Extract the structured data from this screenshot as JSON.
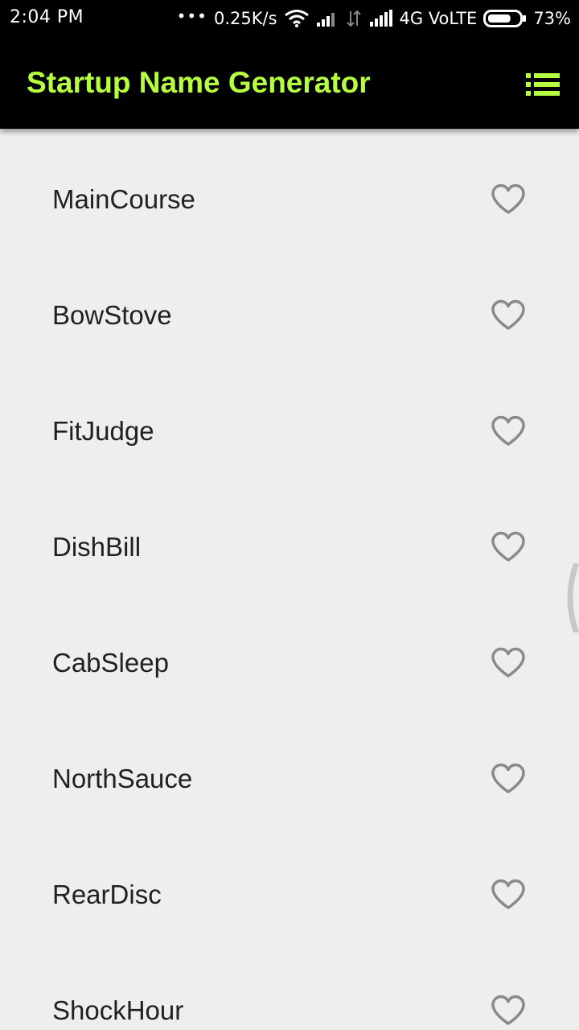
{
  "status_bar": {
    "time": "2:04 PM",
    "dots": "•••",
    "network_speed": "0.25K/s",
    "carrier": "4G VoLTE",
    "battery_percent": "73%",
    "battery_level": 0.73,
    "icons": [
      "wifi-icon",
      "signal-icon",
      "data-transfer-icon",
      "signal-icon",
      "battery-icon"
    ]
  },
  "app_bar": {
    "title": "Startup Name Generator",
    "title_color": "#b5ff40",
    "background": "#000000",
    "action_icon": "list-icon"
  },
  "list": {
    "items": [
      {
        "label": "MainCourse",
        "favorite": false
      },
      {
        "label": "BowStove",
        "favorite": false
      },
      {
        "label": "FitJudge",
        "favorite": false
      },
      {
        "label": "DishBill",
        "favorite": false
      },
      {
        "label": "CabSleep",
        "favorite": false
      },
      {
        "label": "NorthSauce",
        "favorite": false
      },
      {
        "label": "RearDisc",
        "favorite": false
      },
      {
        "label": "ShockHour",
        "favorite": false
      }
    ],
    "item_icon": "heart-outline-icon",
    "icon_color": "#8a8a8a"
  }
}
